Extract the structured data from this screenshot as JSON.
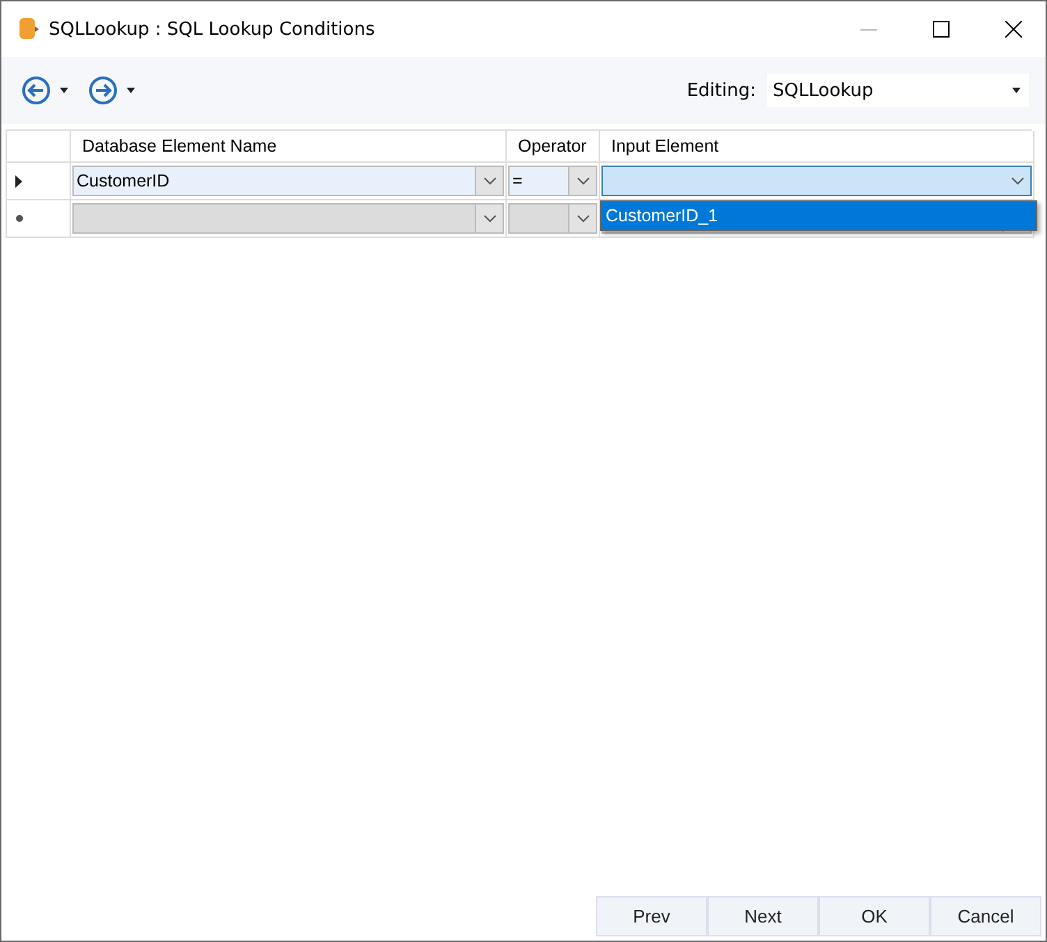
{
  "window": {
    "title": "SQLLookup : SQL Lookup Conditions"
  },
  "toolbar": {
    "editing_label": "Editing:",
    "editing_value": "SQLLookup"
  },
  "table": {
    "columns": [
      "Database Element Name",
      "Operator",
      "Input Element"
    ],
    "rows": [
      {
        "kind": "current",
        "cells": [
          {
            "value": "CustomerID",
            "focused": false
          },
          {
            "value": "=",
            "focused": false
          },
          {
            "focused": true
          }
        ]
      },
      {
        "kind": "new",
        "cells": [
          {
            "focused": false
          },
          {
            "focused": false
          },
          {
            "focused": false
          }
        ]
      }
    ]
  },
  "dropdown": {
    "options": [
      {
        "label": "CustomerID_1",
        "selected": true
      }
    ]
  },
  "buttons": [
    "Prev",
    "Next",
    "OK",
    "Cancel"
  ]
}
